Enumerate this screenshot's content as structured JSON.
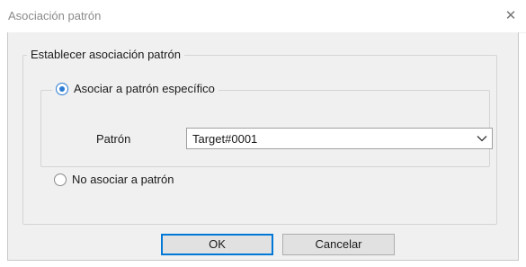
{
  "window": {
    "title": "Asociación patrón",
    "close_glyph": "✕"
  },
  "group": {
    "legend": "Establecer asociación patrón",
    "option_specific": {
      "label": "Asociar a patrón específico",
      "checked": true
    },
    "option_none": {
      "label": "No asociar a patrón",
      "checked": false
    }
  },
  "pattern": {
    "label": "Patrón",
    "selected": "Target#0001",
    "arrow_icon": "chevron-down-icon"
  },
  "buttons": {
    "ok": "OK",
    "cancel": "Cancelar"
  },
  "colors": {
    "accent": "#2b7cd3",
    "dialog_bg": "#f0f0f0"
  }
}
